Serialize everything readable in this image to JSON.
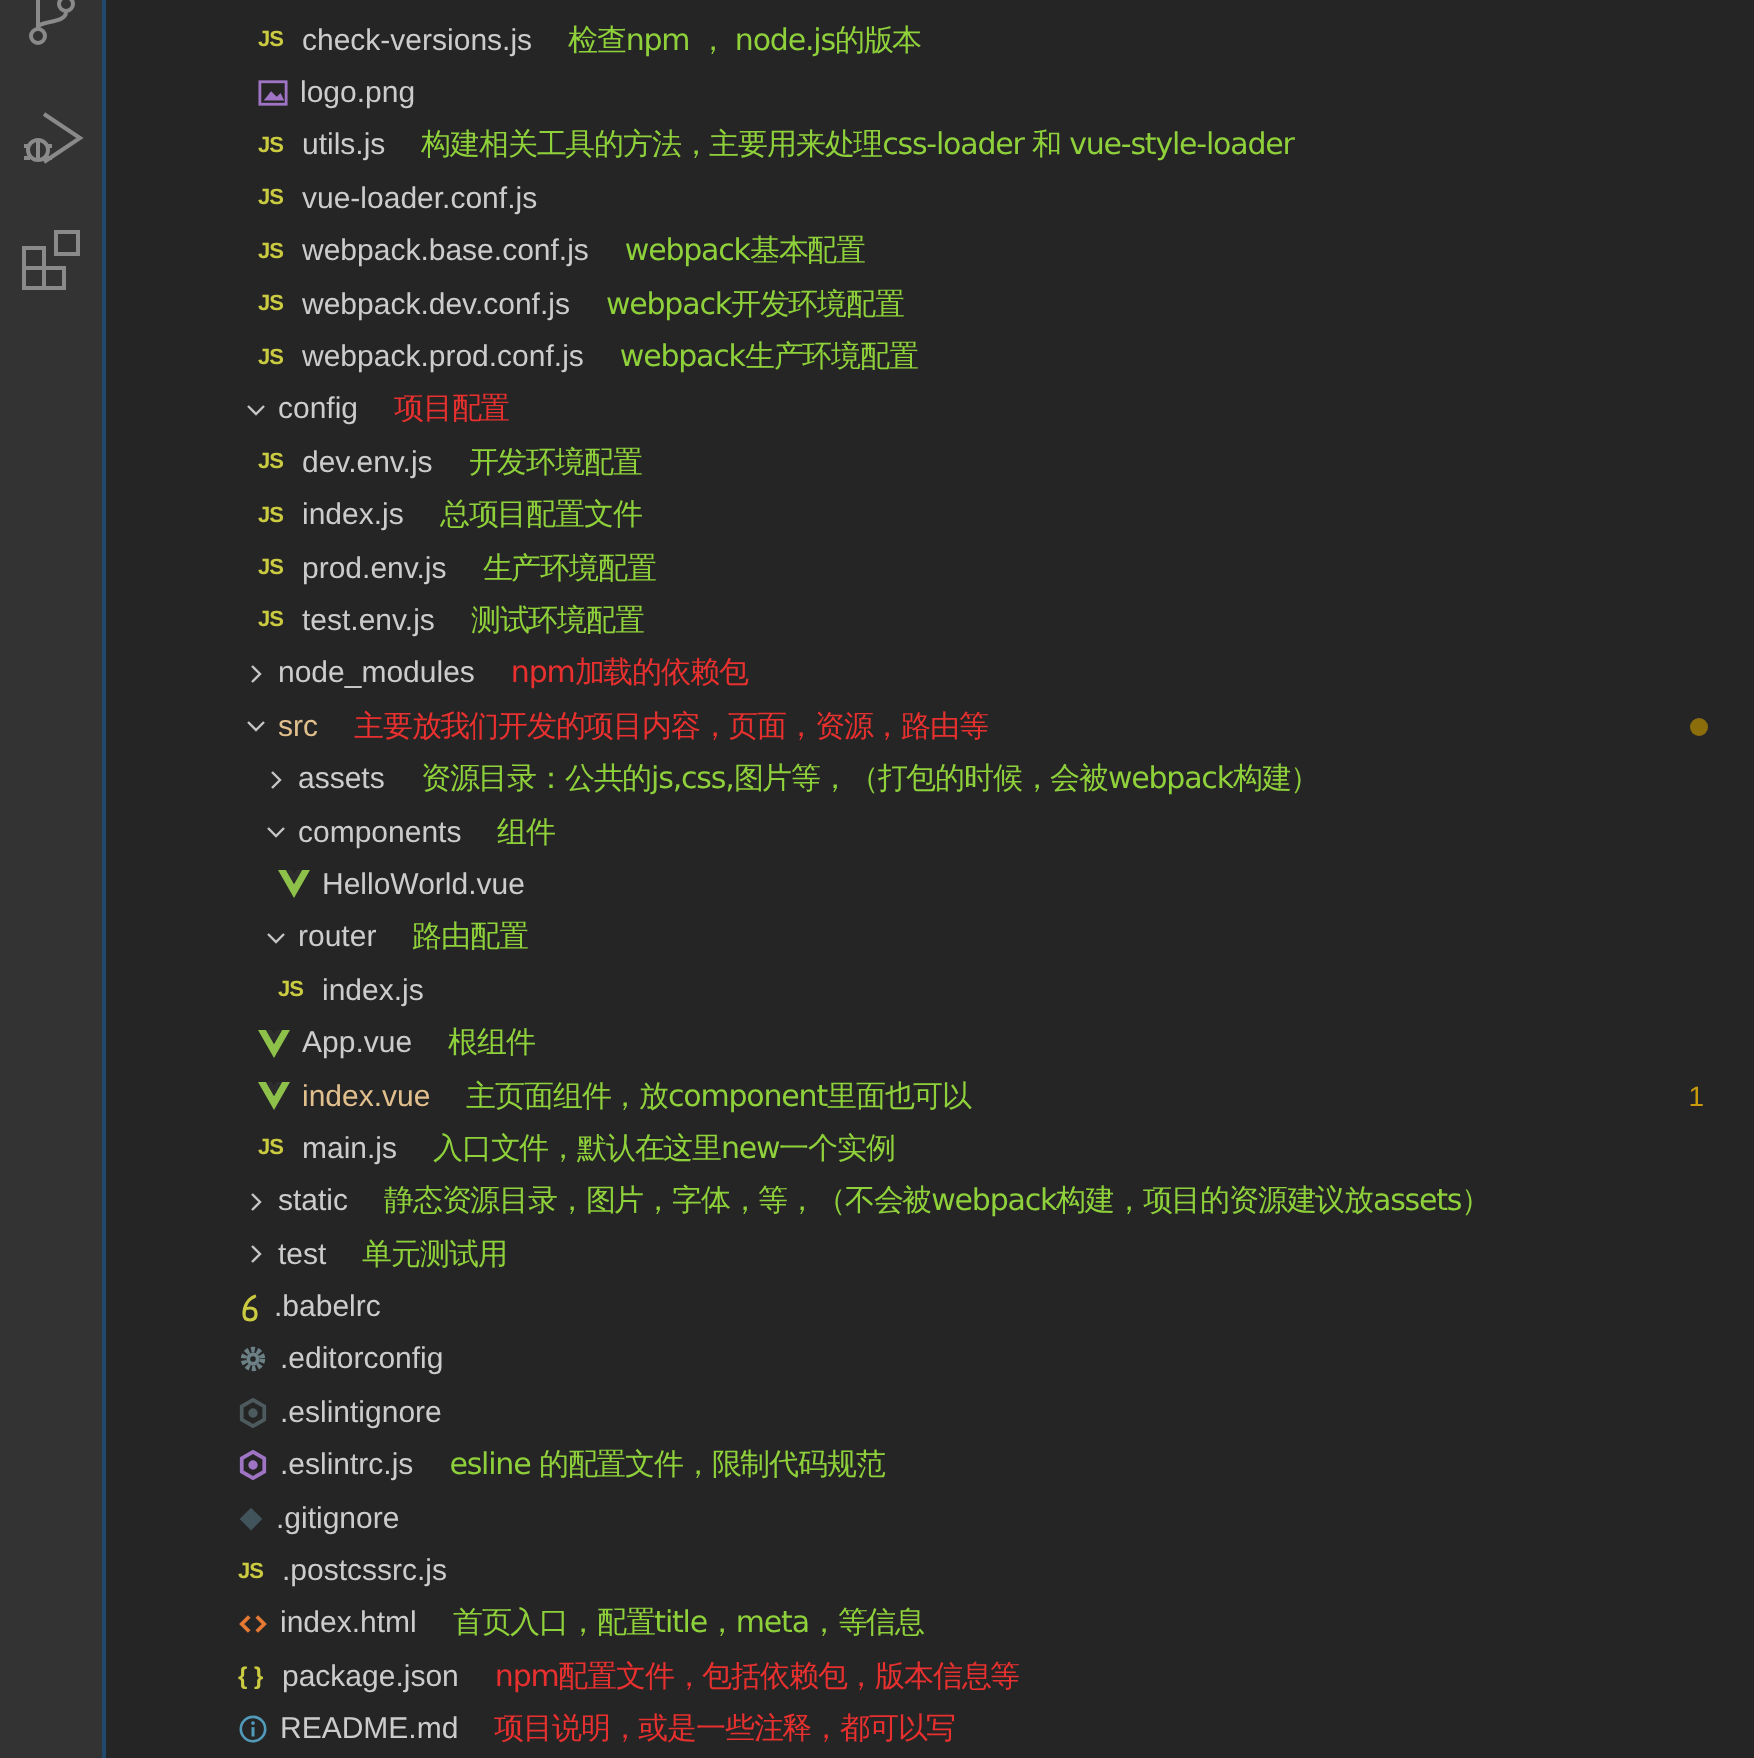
{
  "build_files": [
    {
      "name": "check-versions.js",
      "kind": "js",
      "glyph": "JS",
      "note": "检查npm ， node.js的版本",
      "color": "#8fd13a"
    },
    {
      "name": "logo.png",
      "kind": "image"
    },
    {
      "name": "utils.js",
      "kind": "js",
      "glyph": "JS",
      "note": "构建相关工具的方法，主要用来处理css-loader 和 vue-style-loader",
      "color": "#8fd13a"
    },
    {
      "name": "vue-loader.conf.js",
      "kind": "js",
      "glyph": "JS"
    },
    {
      "name": "webpack.base.conf.js",
      "kind": "js",
      "glyph": "JS",
      "note": "webpack基本配置",
      "color": "#8fd13a"
    },
    {
      "name": "webpack.dev.conf.js",
      "kind": "js",
      "glyph": "JS",
      "note": "webpack开发环境配置",
      "color": "#8fd13a"
    },
    {
      "name": "webpack.prod.conf.js",
      "kind": "js",
      "glyph": "JS",
      "note": "webpack生产环境配置",
      "color": "#8fd13a"
    }
  ],
  "tree": [
    {
      "name": "config",
      "kind": "folder",
      "expanded": true,
      "note": "项目配置",
      "color": "#e8312f",
      "children": [
        {
          "name": "dev.env.js",
          "kind": "js",
          "glyph": "JS",
          "note": "开发环境配置",
          "color": "#8fd13a"
        },
        {
          "name": "index.js",
          "kind": "js",
          "glyph": "JS",
          "note": "总项目配置文件",
          "color": "#8fd13a"
        },
        {
          "name": "prod.env.js",
          "kind": "js",
          "glyph": "JS",
          "note": "生产环境配置",
          "color": "#8fd13a"
        },
        {
          "name": "test.env.js",
          "kind": "js",
          "glyph": "JS",
          "note": "测试环境配置",
          "color": "#8fd13a"
        }
      ]
    },
    {
      "name": "node_modules",
      "kind": "folder",
      "expanded": false,
      "note": "npm加载的依赖包",
      "color": "#e8312f"
    },
    {
      "name": "src",
      "kind": "folder",
      "expanded": true,
      "modified": true,
      "note": "主要放我们开发的项目内容，页面，资源，路由等",
      "color": "#e8312f",
      "children": [
        {
          "name": "assets",
          "kind": "folder",
          "expanded": false,
          "note": "资源目录：公共的js,css,图片等，（打包的时候，会被webpack构建）",
          "color": "#8fd13a"
        },
        {
          "name": "components",
          "kind": "folder",
          "expanded": true,
          "note": "组件",
          "color": "#8fd13a",
          "children": [
            {
              "name": "HelloWorld.vue",
              "kind": "vue"
            }
          ]
        },
        {
          "name": "router",
          "kind": "folder",
          "expanded": true,
          "note": "路由配置",
          "color": "#8fd13a",
          "children": [
            {
              "name": "index.js",
              "kind": "js",
              "glyph": "JS"
            }
          ]
        },
        {
          "name": "App.vue",
          "kind": "vue",
          "note": "根组件",
          "color": "#8fd13a"
        },
        {
          "name": "index.vue",
          "kind": "vue",
          "modified": true,
          "badge": "1",
          "note": "主页面组件，放component里面也可以",
          "color": "#8fd13a"
        },
        {
          "name": "main.js",
          "kind": "js",
          "glyph": "JS",
          "note": "入口文件，默认在这里new一个实例",
          "color": "#8fd13a"
        }
      ]
    },
    {
      "name": "static",
      "kind": "folder",
      "expanded": false,
      "note": "静态资源目录，图片，字体，等，（不会被webpack构建，项目的资源建议放assets）",
      "color": "#8fd13a"
    },
    {
      "name": "test",
      "kind": "folder",
      "expanded": false,
      "note": "单元测试用",
      "color": "#8fd13a"
    },
    {
      "name": ".babelrc",
      "kind": "babel"
    },
    {
      "name": ".editorconfig",
      "kind": "gear"
    },
    {
      "name": ".eslintignore",
      "kind": "eslint-ignore"
    },
    {
      "name": ".eslintrc.js",
      "kind": "eslint",
      "note": "esline 的配置文件，限制代码规范",
      "color": "#8fd13a"
    },
    {
      "name": ".gitignore",
      "kind": "git"
    },
    {
      "name": ".postcssrc.js",
      "kind": "js",
      "glyph": "JS"
    },
    {
      "name": "index.html",
      "kind": "html",
      "note": "首页入口，配置title，meta，等信息",
      "color": "#8fd13a"
    },
    {
      "name": "package.json",
      "kind": "json",
      "glyph": "{ }",
      "note": "npm配置文件，包括依赖包，版本信息等",
      "color": "#e8312f"
    },
    {
      "name": "README.md",
      "kind": "info",
      "note": "项目说明，或是一些注释，都可以写",
      "color": "#e8312f"
    }
  ]
}
